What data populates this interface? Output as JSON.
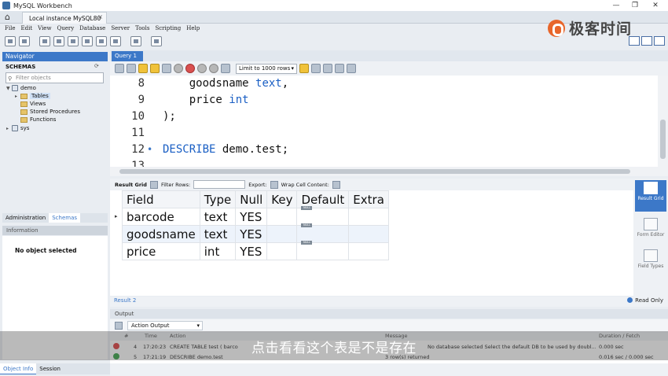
{
  "window": {
    "title": "MySQL Workbench",
    "connection_tab": "Local instance MySQL80",
    "tab_close": "×",
    "minimize": "—",
    "restore": "❐",
    "close": "✕"
  },
  "menu": [
    "File",
    "Edit",
    "View",
    "Query",
    "Database",
    "Server",
    "Tools",
    "Scripting",
    "Help"
  ],
  "logo": {
    "text": "极客时间",
    "color": "#e8662b"
  },
  "navigator": {
    "header": "Navigator",
    "schemas_label": "SCHEMAS",
    "filter_placeholder": "Filter objects",
    "tree": {
      "demo": "demo",
      "tables": "Tables",
      "views": "Views",
      "procedures": "Stored Procedures",
      "functions": "Functions",
      "sys": "sys"
    },
    "bottom_tabs": [
      "Administration",
      "Schemas"
    ],
    "information_header": "Information",
    "no_object": "No object selected",
    "footer_tabs": [
      "Object Info",
      "Session"
    ]
  },
  "query": {
    "tab_label": "Query 1",
    "limit_label": "Limit to 1000 rows",
    "lines": [
      {
        "num": "8",
        "marker": "",
        "pre": "    ",
        "kw": "",
        "text": "goodsname ",
        "kw2": "text",
        "post": ","
      },
      {
        "num": "9",
        "marker": "",
        "pre": "    ",
        "kw": "",
        "text": "price ",
        "kw2": "int",
        "post": ""
      },
      {
        "num": "10",
        "marker": "",
        "pre": "",
        "kw": "",
        "text": ");",
        "kw2": "",
        "post": ""
      },
      {
        "num": "11",
        "marker": "",
        "pre": "",
        "kw": "",
        "text": "",
        "kw2": "",
        "post": ""
      },
      {
        "num": "12",
        "marker": "•",
        "pre": "",
        "kw": "DESCRIBE",
        "text": " demo.test;",
        "kw2": "",
        "post": ""
      },
      {
        "num": "13",
        "marker": "",
        "pre": "",
        "kw": "",
        "text": "",
        "kw2": "",
        "post": ""
      }
    ]
  },
  "result_toolbar": {
    "result_grid": "Result Grid",
    "filter_rows": "Filter Rows:",
    "export": "Export:",
    "wrap": "Wrap Cell Content:"
  },
  "result": {
    "columns": [
      "Field",
      "Type",
      "Null",
      "Key",
      "Default",
      "Extra"
    ],
    "rows": [
      [
        "barcode",
        "text",
        "YES",
        "",
        "NULL",
        ""
      ],
      [
        "goodsname",
        "text",
        "YES",
        "",
        "NULL",
        ""
      ],
      [
        "price",
        "int",
        "YES",
        "",
        "NULL",
        ""
      ]
    ],
    "row_indicator": "▸"
  },
  "side_panel": {
    "result_grid": "Result Grid",
    "form_editor": "Form Editor",
    "field_types": "Field Types"
  },
  "result_tabs": {
    "tab": "Result 2",
    "read_only": "Read Only"
  },
  "output": {
    "header": "Output",
    "selector": "Action Output",
    "columns": {
      "num": "#",
      "time": "Time",
      "action": "Action",
      "message": "Message",
      "duration": "Duration / Fetch"
    },
    "rows": [
      {
        "status": "error",
        "num": "4",
        "time": "17:20:23",
        "action": "CREATE TABLE test ( barco",
        "message": "No database selected Select the default DB to be used by doubl...",
        "duration": "0.000 sec"
      },
      {
        "status": "ok",
        "num": "5",
        "time": "17:21:19",
        "action": "DESCRIBE demo.test",
        "message": "3 row(s) returned",
        "duration": "0.016 sec / 0.000 sec"
      }
    ]
  },
  "subtitle": "点击看看这个表是不是存在"
}
